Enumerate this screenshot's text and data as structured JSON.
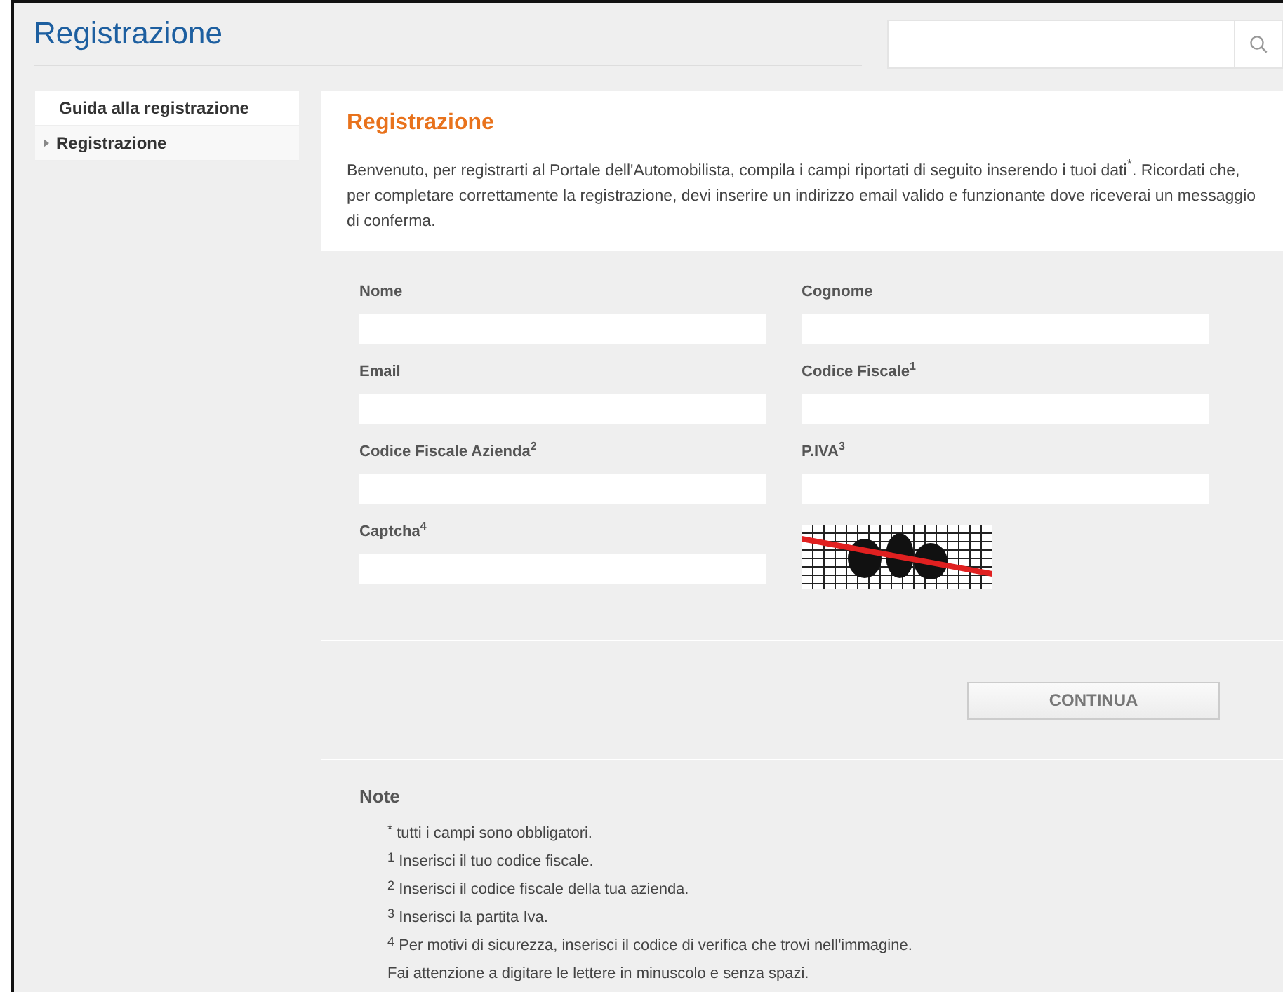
{
  "header": {
    "title": "Registrazione"
  },
  "sidebar": {
    "items": [
      {
        "label": "Guida alla registrazione",
        "selected": false
      },
      {
        "label": "Registrazione",
        "selected": true
      }
    ]
  },
  "main": {
    "title": "Registrazione",
    "intro": "Benvenuto, per registrarti al Portale dell'Automobilista, compila i campi riportati di seguito inserendo i tuoi dati$^{*}$. Ricordati che, per completare correttamente la registrazione, devi inserire un indirizzo email valido e funzionante dove riceverai un messaggio di conferma.",
    "fields": [
      {
        "kind": "input",
        "label": "Nome"
      },
      {
        "kind": "input",
        "label": "Cognome"
      },
      {
        "kind": "input",
        "label": "Email"
      },
      {
        "kind": "input",
        "label": "Codice Fiscale$^{1}$"
      },
      {
        "kind": "input",
        "label": "Codice Fiscale Azienda$^{2}$"
      },
      {
        "kind": "input",
        "label": "P.IVA$^{3}$"
      },
      {
        "kind": "input",
        "label": "Captcha$^{4}$"
      },
      {
        "kind": "picture"
      }
    ],
    "button": "CONTINUA",
    "notes": {
      "title": "Note",
      "lines": [
        "$^{*}$ tutti i campi sono obbligatori.",
        "$^{1}$ Inserisci il tuo codice fiscale.",
        "$^{2}$ Inserisci il codice fiscale della tua azienda.",
        "$^{3}$ Inserisci la partita Iva.",
        "$^{4}$ Per motivi di sicurezza, inserisci il codice di verifica che trovi nell'immagine.",
        "Fai attenzione a digitare le lettere in minuscolo e senza spazi."
      ]
    }
  }
}
